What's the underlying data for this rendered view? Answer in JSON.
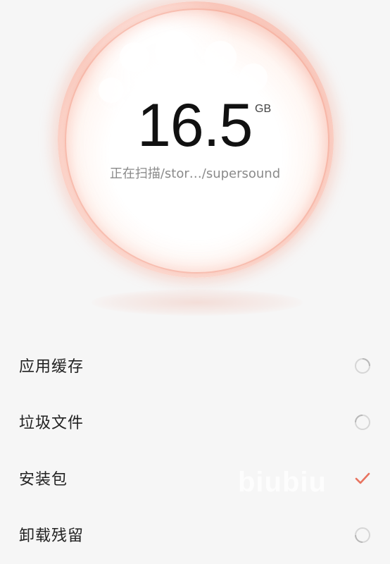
{
  "scan": {
    "size_value": "16.5",
    "size_unit": "GB",
    "status_text": "正在扫描/stor…/supersound"
  },
  "categories": [
    {
      "label": "应用缓存",
      "state": "scanning",
      "icon": "loading-ring-icon"
    },
    {
      "label": "垃圾文件",
      "state": "scanning",
      "icon": "loading-ring-icon"
    },
    {
      "label": "安装包",
      "state": "done",
      "icon": "check-icon"
    },
    {
      "label": "卸载残留",
      "state": "scanning",
      "icon": "loading-ring-icon"
    }
  ],
  "colors": {
    "accent": "#e8735f",
    "sphere_glow": "#f4a08c",
    "background": "#f6f6f6"
  },
  "watermark": "biubiu"
}
